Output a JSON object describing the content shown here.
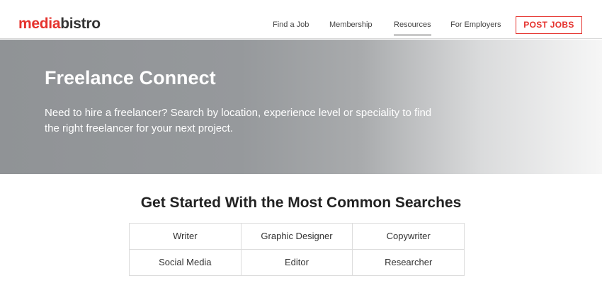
{
  "header": {
    "logo_part1": "media",
    "logo_part2": "bistro",
    "nav": [
      "Find a Job",
      "Membership",
      "Resources",
      "For Employers"
    ],
    "active_nav": "Resources",
    "post_jobs_label": "POST JOBS"
  },
  "hero": {
    "title": "Freelance Connect",
    "description": "Need to hire a freelancer? Search by location, experience level or speciality to find the right freelancer for your next project."
  },
  "searches": {
    "title": "Get Started With the Most Common Searches",
    "items": [
      [
        "Writer",
        "Graphic Designer",
        "Copywriter"
      ],
      [
        "Social Media",
        "Editor",
        "Researcher"
      ]
    ]
  },
  "colors": {
    "brand": "#e5322d",
    "hero_gray": "#909396"
  }
}
